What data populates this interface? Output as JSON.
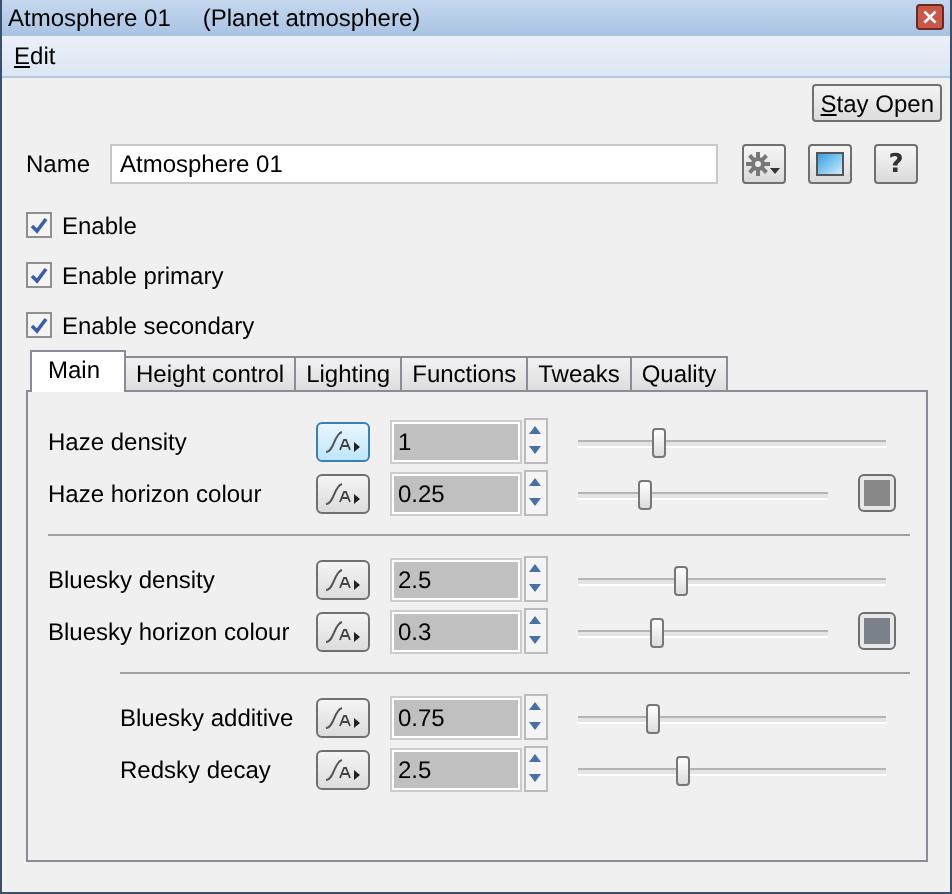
{
  "window": {
    "title": "Atmosphere 01",
    "subtitle": "(Planet atmosphere)",
    "close": "×"
  },
  "menu": [
    {
      "label": "Edit"
    }
  ],
  "stay_open": "Stay Open",
  "name": {
    "label": "Name",
    "value": "Atmosphere 01"
  },
  "help": "?",
  "checks": [
    {
      "label": "Enable",
      "checked": true
    },
    {
      "label": "Enable primary",
      "checked": true
    },
    {
      "label": "Enable secondary",
      "checked": true
    }
  ],
  "tabs": [
    {
      "label": "Main",
      "selected": true
    },
    {
      "label": "Height control",
      "selected": false
    },
    {
      "label": "Lighting",
      "selected": false
    },
    {
      "label": "Functions",
      "selected": false
    },
    {
      "label": "Tweaks",
      "selected": false
    },
    {
      "label": "Quality",
      "selected": false
    }
  ],
  "groups": [
    {
      "indented": false,
      "rows": [
        {
          "label": "Haze density",
          "value": "1",
          "level": 0.26,
          "highlighted": true
        },
        {
          "label": "Haze horizon colour",
          "value": "0.25",
          "level": 0.26,
          "highlighted": false,
          "color": "#888888"
        }
      ]
    },
    {
      "indented": false,
      "rows": [
        {
          "label": "Bluesky density",
          "value": "2.5",
          "level": 0.33,
          "highlighted": false
        },
        {
          "label": "Bluesky horizon colour",
          "value": "0.3",
          "level": 0.31,
          "highlighted": false,
          "color": "#7b8189"
        }
      ]
    },
    {
      "indented": true,
      "rows": [
        {
          "label": "Bluesky additive",
          "value": "0.75",
          "level": 0.24,
          "highlighted": false
        },
        {
          "label": "Redsky decay",
          "value": "2.5",
          "level": 0.34,
          "highlighted": false
        }
      ]
    }
  ]
}
